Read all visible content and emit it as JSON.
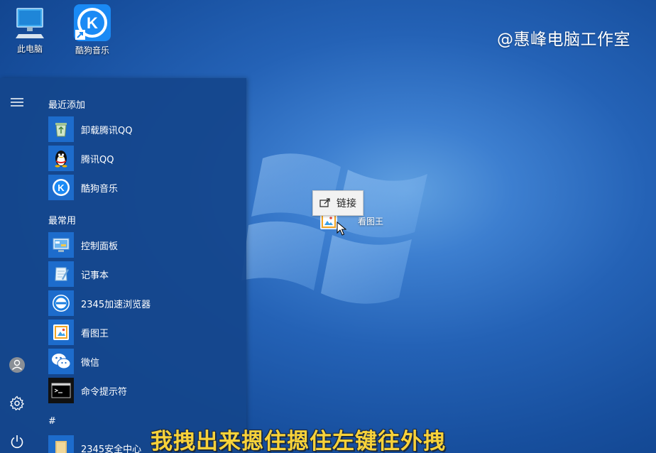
{
  "watermark": "@惠峰电脑工作室",
  "desktop_icons": [
    {
      "label": "此电脑",
      "icon": "computer-icon"
    },
    {
      "label": "酷狗音乐",
      "icon": "kugou-icon"
    }
  ],
  "drag": {
    "tooltip_label": "链接",
    "tooltip_icon": "link-arrow-icon",
    "ghost_label": "看图王"
  },
  "start_menu": {
    "recent_header": "最近添加",
    "recent_items": [
      {
        "label": "卸载腾讯QQ",
        "icon": "recycle-bin-icon"
      },
      {
        "label": "腾讯QQ",
        "icon": "qq-penguin-icon"
      },
      {
        "label": "酷狗音乐",
        "icon": "kugou-icon"
      }
    ],
    "frequent_header": "最常用",
    "frequent_items": [
      {
        "label": "控制面板",
        "icon": "control-panel-icon"
      },
      {
        "label": "记事本",
        "icon": "notepad-icon"
      },
      {
        "label": "2345加速浏览器",
        "icon": "browser-2345-icon"
      },
      {
        "label": "看图王",
        "icon": "image-viewer-icon"
      },
      {
        "label": "微信",
        "icon": "wechat-icon"
      },
      {
        "label": "命令提示符",
        "icon": "cmd-icon"
      }
    ],
    "hash_header": "#",
    "hash_items": [
      {
        "label": "2345安全中心",
        "icon": "folder-icon"
      }
    ]
  },
  "subtitle": "我拽出来摁住摁住左键往外拽",
  "colors": {
    "tile_blue": "#1d6ccc",
    "subtitle_yellow": "#f8d23a",
    "menu_bg": "#14468c"
  }
}
